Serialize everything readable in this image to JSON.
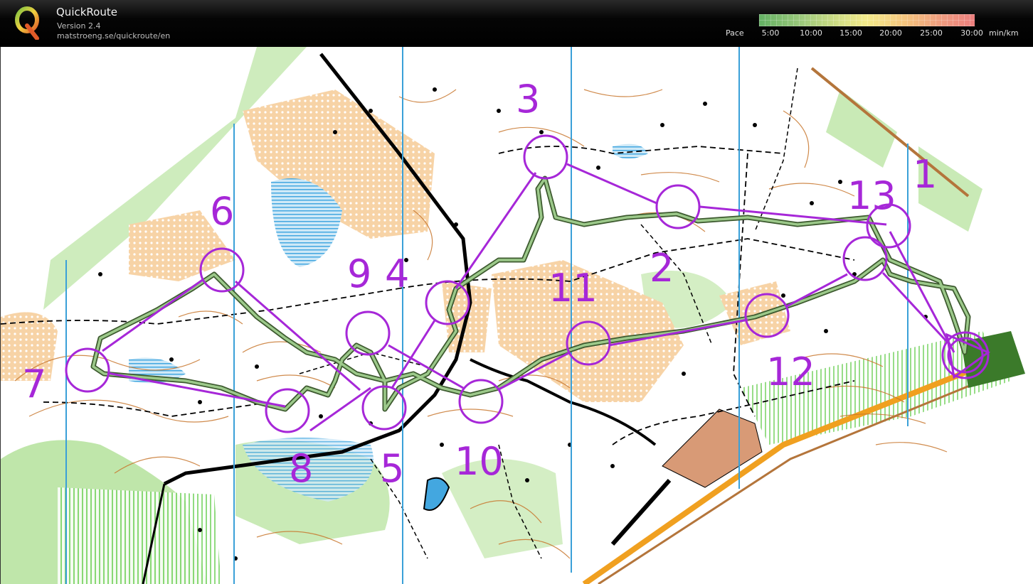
{
  "header": {
    "title": "QuickRoute",
    "version": "Version 2.4",
    "url": "matstroeng.se/quickroute/en",
    "logo_icon": "quickroute-q-logo-icon"
  },
  "pace_legend": {
    "label": "Pace",
    "ticks": [
      "5:00",
      "10:00",
      "15:00",
      "20:00",
      "25:00",
      "30:00"
    ],
    "unit": "min/km",
    "colors": [
      "#63b163",
      "#d5df86",
      "#f3ea8a",
      "#f5c47e",
      "#ec7e7e"
    ]
  },
  "map": {
    "course_color": "#a627d8",
    "meridian_color": "#3aa0d8",
    "controls": [
      "1",
      "2",
      "3",
      "4",
      "5",
      "6",
      "7",
      "8",
      "9",
      "10",
      "11",
      "12",
      "13"
    ]
  }
}
